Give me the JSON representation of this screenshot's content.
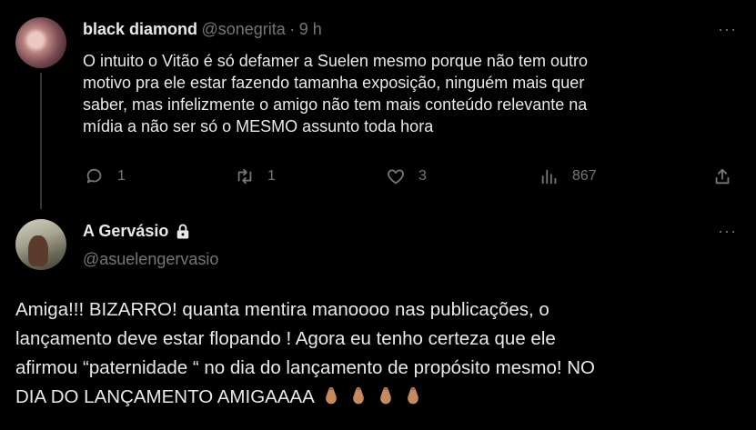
{
  "reply_tweet": {
    "author_name": "black diamond",
    "author_handle": "@sonegrita",
    "separator": "·",
    "time": "9 h",
    "text": "O intuito o Vitão é só defamer a Suelen mesmo porque não tem outro\nmotivo pra ele estar fazendo tamanha exposição, ninguém mais quer\nsaber,  mas infelizmente o amigo não tem mais conteúdo relevante na\nmídia a não ser só o MESMO assunto toda hora",
    "replies": "1",
    "retweets": "1",
    "likes": "3",
    "views": "867",
    "more": "···"
  },
  "main_tweet": {
    "author_name": "A Gervásio",
    "author_handle": "@asuelengervasio",
    "protected": true,
    "text": "Amiga!!! BIZARRO! quanta mentira manoooo nas publicações, o\nlançamento deve estar flopando ! Agora eu tenho certeza que ele\nafirmou “paternidade “ no dia do lançamento de propósito mesmo! NO\nDIA DO LANÇAMENTO AMIGAAAA",
    "emoji_count": 4,
    "emoji_color": "#c68a5e",
    "more": "···"
  },
  "colors": {
    "background": "#000000",
    "text": "#e7e9ea",
    "secondary": "#71767b"
  }
}
